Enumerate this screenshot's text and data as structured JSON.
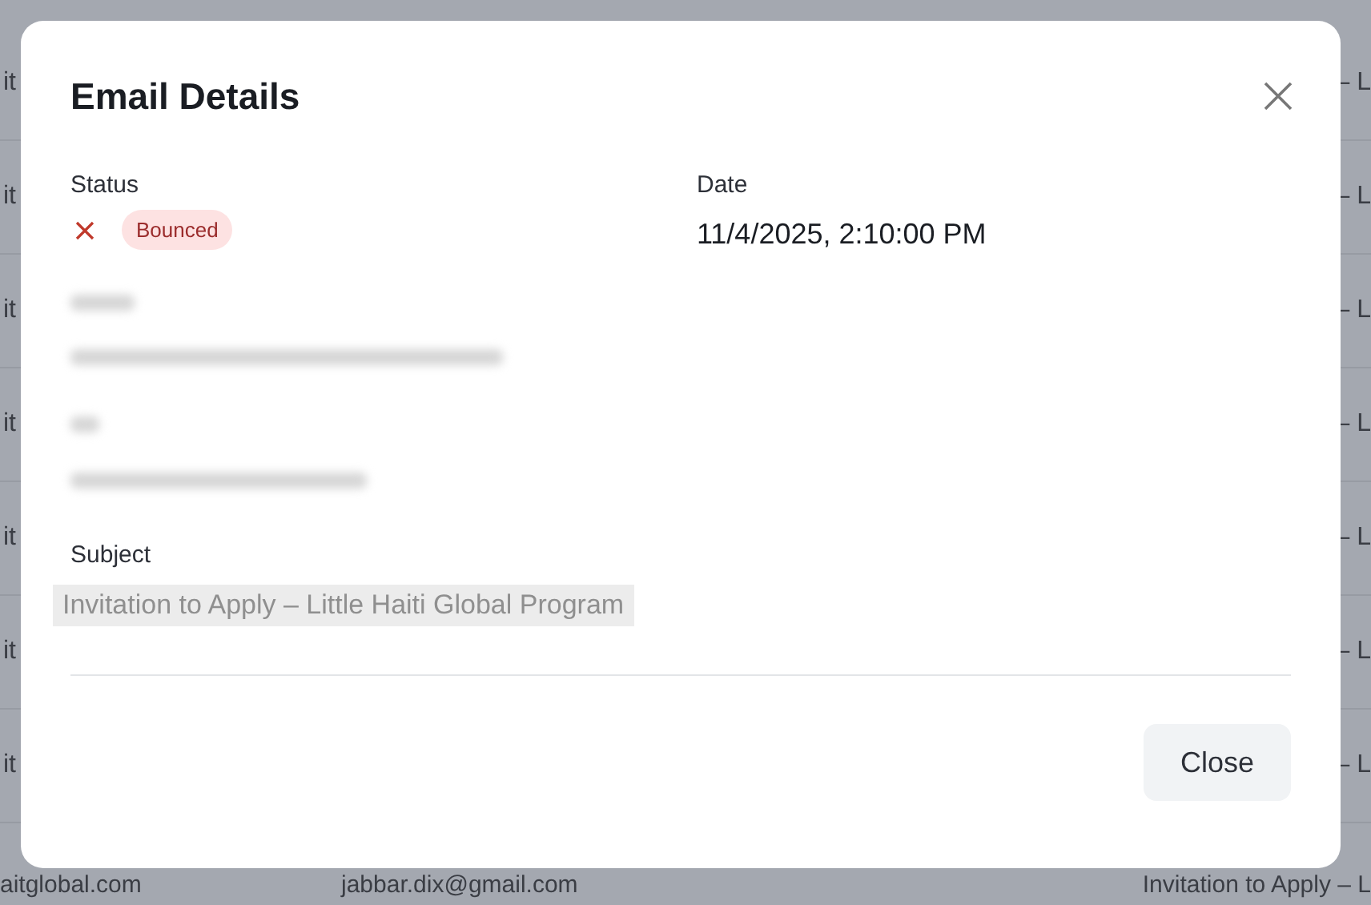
{
  "background_table": {
    "rows": [
      {
        "column_1": "it",
        "column_3": "– L"
      },
      {
        "column_1": "it",
        "column_3": "– L"
      },
      {
        "column_1": "it",
        "column_3": "– L"
      },
      {
        "column_1": "it",
        "column_3": "– L"
      },
      {
        "column_1": "it",
        "column_3": "– L"
      },
      {
        "column_1": "it",
        "column_3": "– L"
      },
      {
        "column_1": "it",
        "column_3": "– L"
      },
      {
        "column_1": "aitglobal.com",
        "column_2": "jabbar.dix@gmail.com",
        "column_3": "Invitation to Apply – L"
      }
    ]
  },
  "dialog": {
    "title": "Email Details",
    "status": {
      "label": "Status",
      "kind": "bounced",
      "badge": "Bounced"
    },
    "date": {
      "label": "Date",
      "value": "11/4/2025, 2:10:00 PM"
    },
    "subject": {
      "label": "Subject",
      "value": "Invitation to Apply – Little Haiti Global Program"
    },
    "buttons": [
      "Close"
    ]
  }
}
